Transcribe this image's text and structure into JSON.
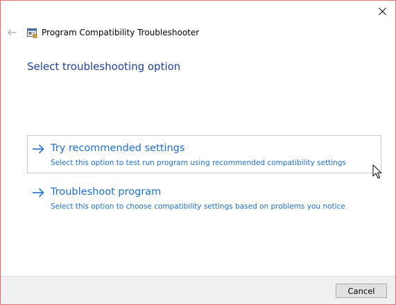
{
  "window": {
    "title": "Program Compatibility Troubleshooter",
    "close_icon": "close-icon",
    "back_icon": "back-arrow-icon",
    "app_icon": "compatibility-troubleshooter-icon"
  },
  "page": {
    "heading": "Select troubleshooting option"
  },
  "options": [
    {
      "icon": "right-arrow-icon",
      "title": "Try recommended settings",
      "description": "Select this option to test run program using recommended compatibility settings",
      "hovered": true
    },
    {
      "icon": "right-arrow-icon",
      "title": "Troubleshoot program",
      "description": "Select this option to choose compatibility settings based on problems you notice",
      "hovered": false
    }
  ],
  "footer": {
    "cancel_label": "Cancel"
  },
  "colors": {
    "heading": "#1f3f9a",
    "link": "#1f6fcf",
    "window_border": "#e36b6b",
    "footer_bg": "#f0f0f0"
  }
}
